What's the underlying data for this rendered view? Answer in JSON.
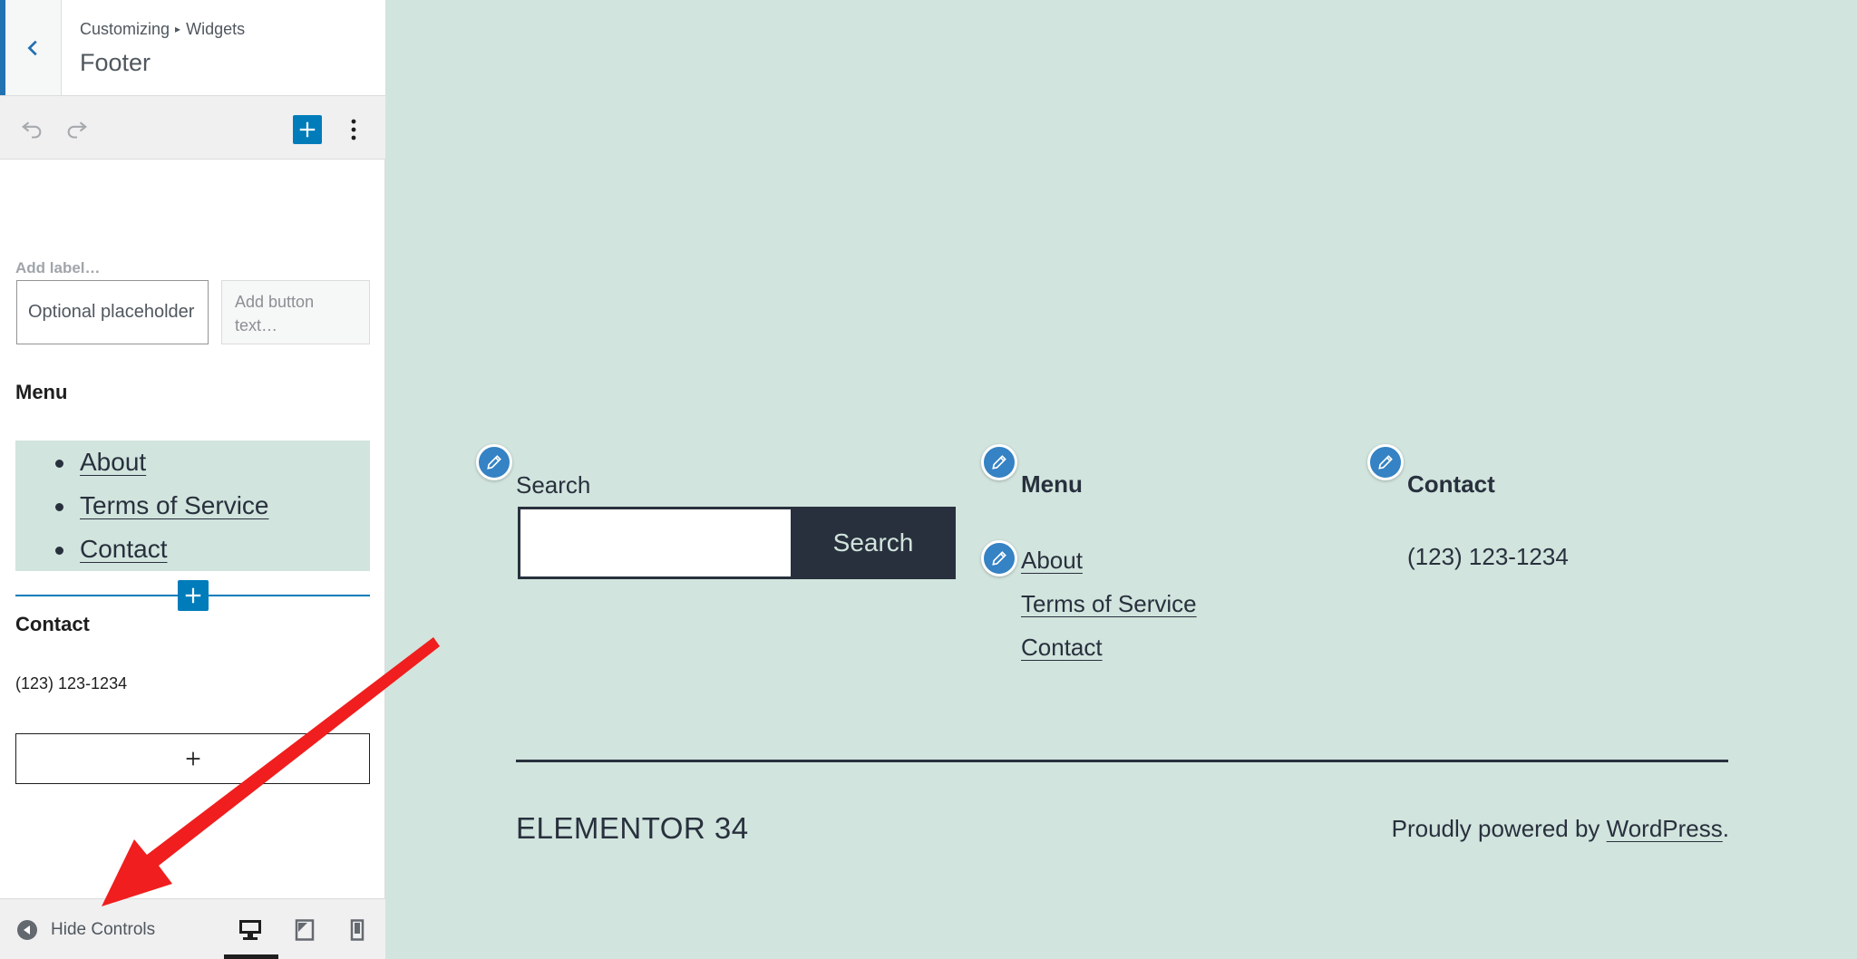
{
  "sidebar": {
    "breadcrumb": {
      "root": "Customizing",
      "separator": "▸",
      "section": "Widgets"
    },
    "title": "Footer",
    "search_block": {
      "label_placeholder": "Add label…",
      "input_placeholder": "Optional placeholder",
      "button_placeholder": "Add button text…"
    },
    "menu_block": {
      "heading": "Menu",
      "items": [
        {
          "label": "About"
        },
        {
          "label": "Terms of Service"
        },
        {
          "label": "Contact"
        }
      ]
    },
    "contact_block": {
      "heading": "Contact",
      "phone": "(123) 123-1234"
    },
    "footer": {
      "hide_controls_label": "Hide Controls"
    }
  },
  "preview": {
    "search": {
      "label": "Search",
      "button_label": "Search"
    },
    "menu": {
      "heading": "Menu",
      "links": [
        {
          "label": "About"
        },
        {
          "label": "Terms of Service"
        },
        {
          "label": "Contact"
        }
      ]
    },
    "contact": {
      "heading": "Contact",
      "phone": "(123) 123-1234"
    },
    "site_name": "ELEMENTOR 34",
    "powered_by": {
      "prefix": "Proudly powered by ",
      "link": "WordPress",
      "suffix": "."
    }
  },
  "colors": {
    "accent": "#007cba",
    "preview_background": "#d1e4dd",
    "text_dark": "#28303d",
    "annotation_arrow": "#f01e1e"
  },
  "icons": {
    "back": "chevron-left-icon",
    "undo": "undo-icon",
    "redo": "redo-icon",
    "add_block": "plus-icon",
    "more": "vertical-ellipsis-icon",
    "hide_controls": "collapse-circle-icon",
    "devices": [
      "desktop-icon",
      "tablet-icon",
      "mobile-icon"
    ],
    "edit": "pencil-icon"
  }
}
